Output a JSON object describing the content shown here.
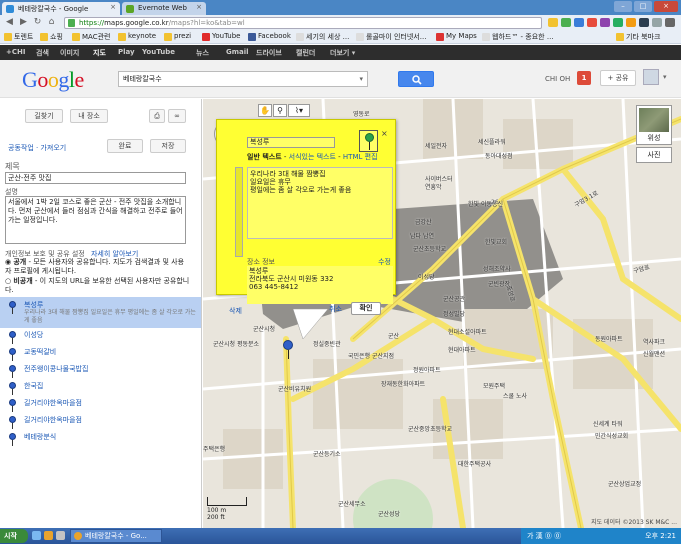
{
  "browser": {
    "tabs": [
      {
        "title": "베테랑칼국수 - Google",
        "active": true
      },
      {
        "title": "Evernote Web",
        "active": false
      }
    ],
    "url_secure": "https://",
    "url_host": "maps.google.co.kr",
    "url_path": "/maps?hl=ko&tab=wl",
    "bookmarks": [
      "토렌트",
      "쇼핑",
      "MAC관련",
      "keynote",
      "prezi",
      "YouTube",
      "Facebook",
      "세기의 세상 ...",
      "롤골마이 인터넷서...",
      "My Maps",
      "웹하드™ - 종요한 ...",
      "기타 북마크"
    ]
  },
  "google_bar": {
    "items": [
      "+CHI",
      "검색",
      "이미지",
      "지도",
      "Play",
      "YouTube",
      "뉴스",
      "Gmail",
      "드라이브",
      "캘린더",
      "더보기 ▾"
    ],
    "active_item": "지도"
  },
  "header": {
    "logo_text": "Google",
    "search_value": "베테랑칼국수",
    "user_name": "CHI OH",
    "notification_count": "1",
    "share_label": "+ 공유"
  },
  "left_panel": {
    "top_buttons": [
      "길찾기",
      "내 장소"
    ],
    "collab_link": "공동작업 · 가져오기",
    "done_button": "완료",
    "save_button": "저장",
    "title_label": "제목",
    "title_value": "군산-전주 맛집",
    "desc_label": "설명",
    "desc_value": "서울에서 1박 2일 코스로 좋은 군산 - 전주 맛집을 소개합니다. 먼저 군산에서 들러 점심과 간식을 해결하고 전주로 들어가는 일정입니다.",
    "share_settings_label": "개인정보 보호 및 공유 설정",
    "learn_more_link": "자세히 알아보기",
    "public_label": "공개",
    "public_desc": " - 모든 사용자와 공유합니다. 지도가 검색결과 및 사용자 프로필에 게시됩니다.",
    "unlisted_label": "비공개",
    "unlisted_desc": " - 이 지도의 URL을 보유한 선택된 사용자만 공유합니다.",
    "places": [
      {
        "name": "복성루",
        "desc": "우리나라 3대 해물 짬뽕집 일요일은 휴무 평일에는 좀 살 각오로 가는 게 좋음",
        "selected": true
      },
      {
        "name": "이성당"
      },
      {
        "name": "교동떡갈비"
      },
      {
        "name": "전주왱이콩나물국밥집"
      },
      {
        "name": "한국집"
      },
      {
        "name": "길거리야한옥마을점"
      },
      {
        "name": "길거리야한옥마을점"
      },
      {
        "name": "베테랑분식"
      }
    ]
  },
  "infowindow": {
    "title_value": "복성루",
    "tab_plain": "일반 텍스트",
    "tab_rich": "서식있는 텍스트",
    "tab_html": "HTML 편집",
    "desc_value": "우리나라 3대 해물 짬뽕집\n일요일은 휴무\n평일에는 좀 살 각오로 가는게 좋음",
    "addr_head": "장소 정보",
    "addr_edit": "수정",
    "addr_lines": [
      "복성루",
      "전라북도 군산시 미원동 332",
      "063 445-8412"
    ],
    "delete_label": "삭제",
    "cancel_label": "취소",
    "ok_label": "확인"
  },
  "map": {
    "sat_label": "위성",
    "photo_label": "사진",
    "scale_m": "100 m",
    "scale_ft": "200 ft",
    "copyright": "지도 데이터 ©2013 SK M&C ...",
    "labels": [
      {
        "text": "세신플라워"
      },
      {
        "text": "동아대성점"
      },
      {
        "text": "세일전자"
      },
      {
        "text": "사이버스터"
      },
      {
        "text": "연흥악"
      },
      {
        "text": "한빛 이동통신"
      },
      {
        "text": "금강산"
      },
      {
        "text": "남다 남연"
      },
      {
        "text": "군산초등학교"
      },
      {
        "text": "한빛교회"
      },
      {
        "text": "군산시청"
      },
      {
        "text": "군산시청 평동분소"
      },
      {
        "text": "이성당"
      },
      {
        "text": "군산공관"
      },
      {
        "text": "성해조약사"
      },
      {
        "text": "군빈광장"
      },
      {
        "text": "정실중빈관"
      },
      {
        "text": "현대소설아파트"
      },
      {
        "text": "군산"
      },
      {
        "text": "국민은행 군산지점"
      },
      {
        "text": "동원아파트"
      },
      {
        "text": "역사파크"
      },
      {
        "text": "신월맨션"
      },
      {
        "text": "현대아파트"
      },
      {
        "text": "정원아파트"
      },
      {
        "text": "모원주택"
      },
      {
        "text": "장재동한화아파트"
      },
      {
        "text": "스쿨 노사"
      },
      {
        "text": "정성빌당"
      },
      {
        "text": "군산비유치원"
      },
      {
        "text": "군산중앙초등학교"
      },
      {
        "text": "신세계 타워"
      },
      {
        "text": "민간식성교회"
      },
      {
        "text": "군산상업교정"
      },
      {
        "text": "대한주택공사"
      },
      {
        "text": "군산등기소"
      },
      {
        "text": "군산세무소"
      },
      {
        "text": "군산성당"
      },
      {
        "text": "주택은행"
      },
      {
        "text": "구암3.1로"
      },
      {
        "text": "구암로"
      },
      {
        "text": "중앙로"
      },
      {
        "text": "영동로"
      },
      {
        "text": "26"
      }
    ]
  },
  "taskbar": {
    "start_label": "시작",
    "task_title": "베테랑칼국수 - Go...",
    "tray_text": "가 漢 ⓪ ⓪",
    "clock": "오후 2:21"
  },
  "colors": {
    "infowindow_bg": "#ffff33",
    "google_blue": "#4787ed",
    "selected_item": "#b9d0f2",
    "road_yellow": "#f5e36b"
  }
}
